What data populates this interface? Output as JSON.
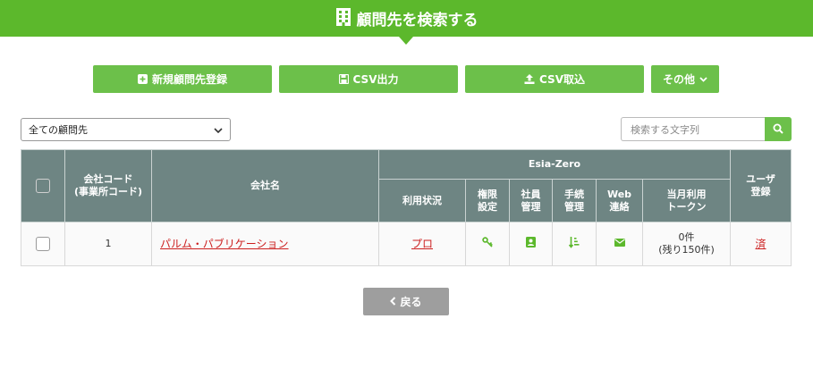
{
  "header": {
    "title": "顧問先を検索する",
    "icon": "building-icon"
  },
  "toolbar": {
    "new_label": "新規顧問先登録",
    "csv_export_label": "CSV出力",
    "csv_import_label": "CSV取込",
    "other_label": "その他"
  },
  "filter": {
    "selected": "全ての顧問先"
  },
  "search": {
    "placeholder": "検索する文字列"
  },
  "table": {
    "headers": {
      "company_code_line1": "会社コード",
      "company_code_line2": "(事業所コード)",
      "company_name": "会社名",
      "group": "Esia-Zero",
      "usage_status": "利用状況",
      "permission_line1": "権限",
      "permission_line2": "設定",
      "employee_line1": "社員",
      "employee_line2": "管理",
      "procedure_line1": "手続",
      "procedure_line2": "管理",
      "web_line1": "Web",
      "web_line2": "連絡",
      "token_line1": "当月利用",
      "token_line2": "トークン",
      "user_line1": "ユーザ",
      "user_line2": "登録"
    },
    "rows": [
      {
        "code": "1",
        "name": "パルム・パブリケーション",
        "usage": "プロ",
        "token_line1": "0件",
        "token_line2": "(残り150件)",
        "user_status": "済"
      }
    ]
  },
  "back_label": "戻る",
  "colors": {
    "brand_green": "#5cb82c",
    "button_green": "#6cc04a",
    "header_gray": "#6e8583",
    "link_red": "#cc1f1f",
    "back_gray": "#9e9e9e"
  }
}
